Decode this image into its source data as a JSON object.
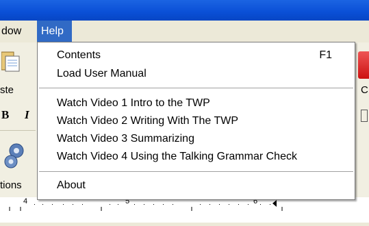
{
  "menubar": {
    "window_label": "dow",
    "help_label": "Help"
  },
  "toolbar": {
    "paste_label": "ste",
    "options_label": "tions",
    "bold_glyph": "B",
    "italic_glyph": "I",
    "right_label": "C"
  },
  "help_menu": {
    "items": [
      {
        "label": "Contents",
        "shortcut": "F1"
      },
      {
        "label": "Load User Manual"
      },
      {
        "label": "Watch Video 1 Intro to the TWP"
      },
      {
        "label": "Watch Video 2  Writing With The TWP"
      },
      {
        "label": "Watch Video 3 Summarizing"
      },
      {
        "label": "Watch Video 4 Using the Talking Grammar Check"
      },
      {
        "label": "About"
      }
    ]
  },
  "ruler": {
    "marks": [
      "4",
      "5",
      "6"
    ]
  },
  "colors": {
    "titlebar": "#0a4fd6",
    "menu_highlight": "#316ac5",
    "menu_bg": "#ece9d8"
  }
}
